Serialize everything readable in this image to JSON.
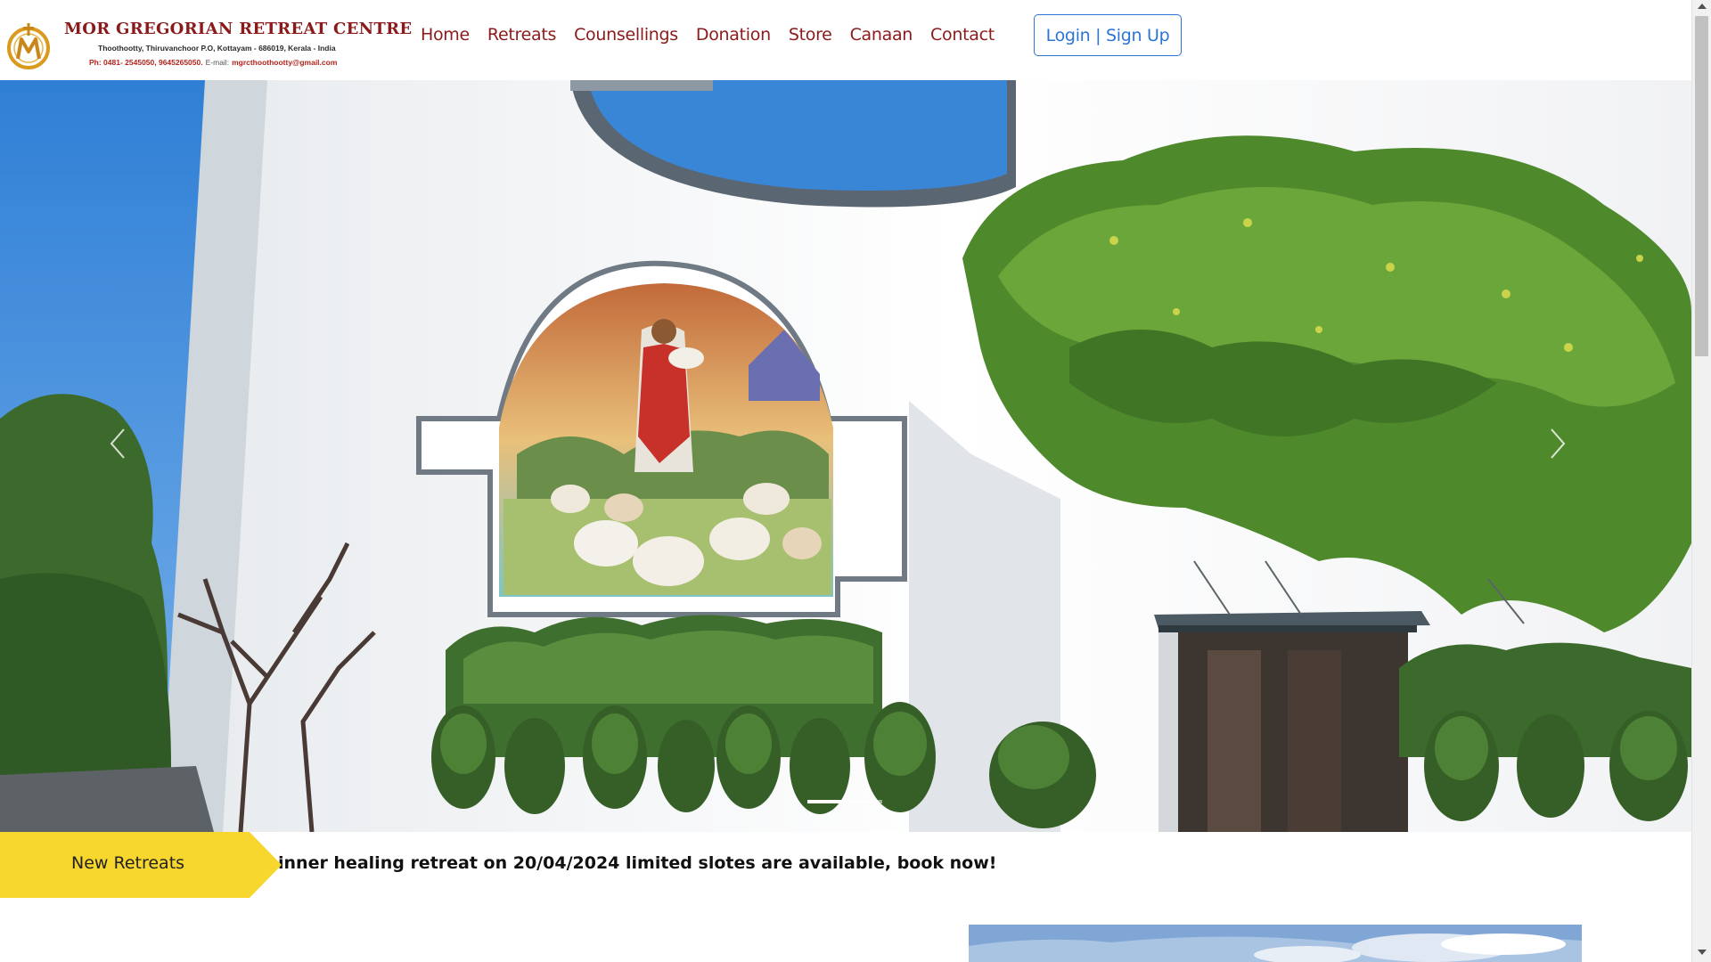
{
  "brand": {
    "name": "MOR GREGORIAN RETREAT CENTRE",
    "address": "Thoothootty, Thiruvanchoor P.O, Kottayam - 686019, Kerala - India",
    "phone": "Ph: 0481- 2545050, 9645265050.",
    "email_label": "E-mail:",
    "email": "mgrcthoothootty@gmail.com",
    "logo_letter": "M"
  },
  "nav": {
    "items": [
      {
        "label": "Home"
      },
      {
        "label": "Retreats"
      },
      {
        "label": "Counsellings"
      },
      {
        "label": "Donation"
      },
      {
        "label": "Store"
      },
      {
        "label": "Canaan"
      },
      {
        "label": "Contact"
      }
    ],
    "login_label": "Login | Sign Up"
  },
  "carousel": {
    "image": "church-with-mosaic-of-good-shepherd",
    "prev_icon": "chevron-left-icon",
    "next_icon": "chevron-right-icon",
    "slide_count": 2,
    "active_index": 0
  },
  "ticker": {
    "label": "New Retreats",
    "text": "inner healing retreat on 20/04/2024 limited slotes are available, book now!"
  },
  "colors": {
    "brand": "#8b1b1b",
    "link_blue": "#2c74d6",
    "ticker_yellow": "#f7d62e",
    "logo_gold": "#d99a1e"
  }
}
